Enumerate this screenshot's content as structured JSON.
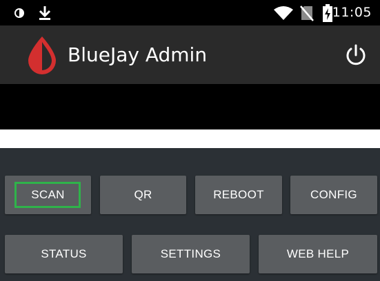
{
  "status_bar": {
    "time": "11:05",
    "icons": [
      "brightness-icon",
      "download-icon",
      "wifi-icon",
      "no-sim-icon",
      "battery-charging-icon"
    ]
  },
  "app_bar": {
    "title": "BlueJay Admin",
    "logo_icon": "drop-logo-icon",
    "power_icon": "power-icon",
    "logo_color": "#d32f2f"
  },
  "buttons": {
    "row1": {
      "scan": "SCAN",
      "qr": "QR",
      "reboot": "REBOOT",
      "config": "CONFIG"
    },
    "row2": {
      "status": "STATUS",
      "settings": "SETTINGS",
      "web_help": "WEB HELP"
    }
  },
  "colors": {
    "focus": "#2fb34a",
    "button_bg": "#5a5d60",
    "background": "#2b3035"
  }
}
